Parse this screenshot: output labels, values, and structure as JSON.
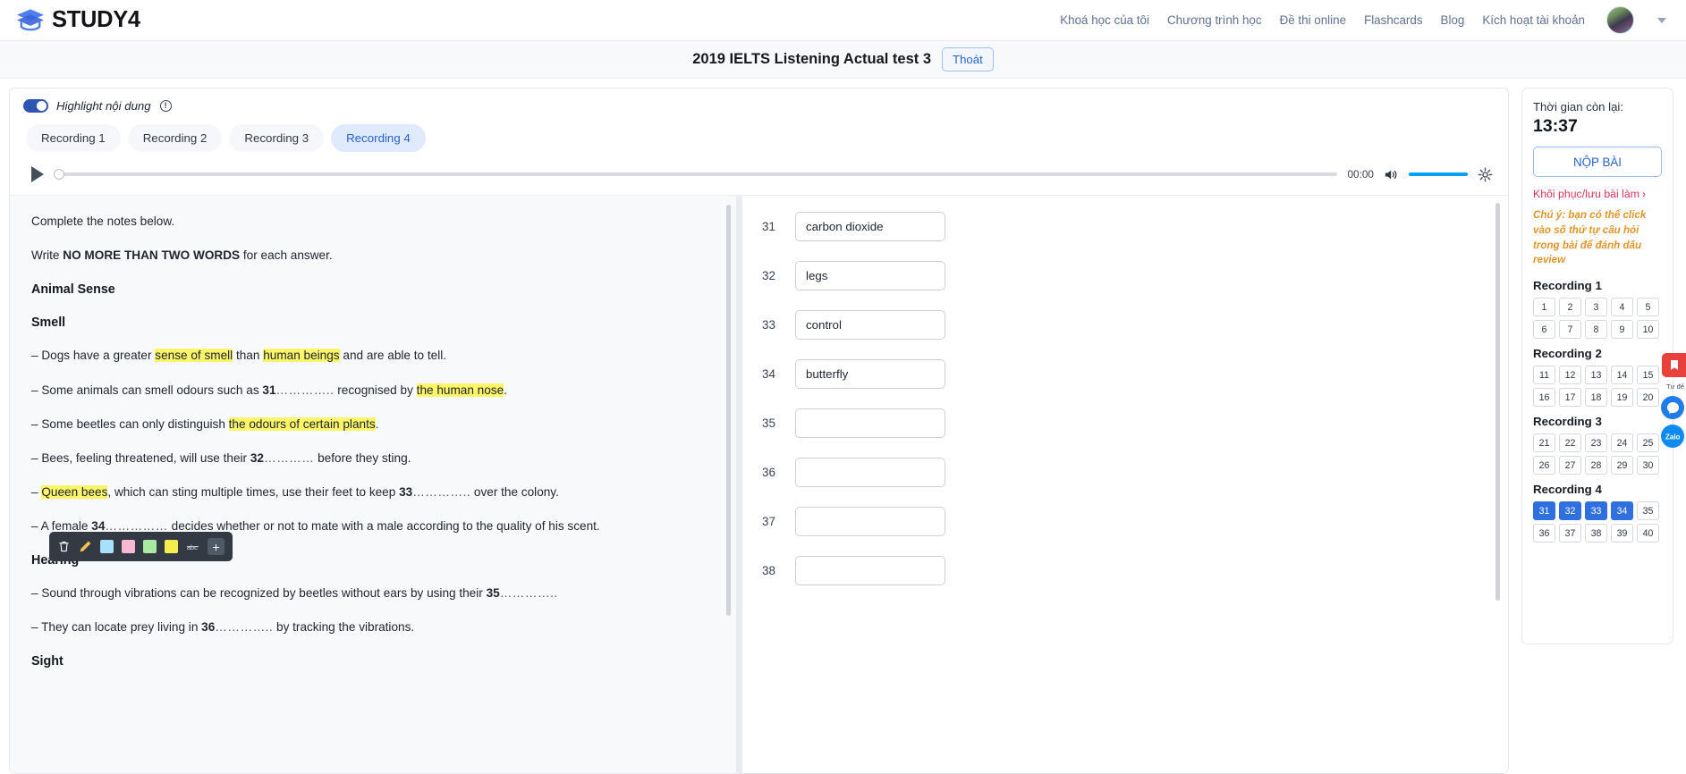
{
  "brand": {
    "name": "STUDY4"
  },
  "nav": {
    "links": [
      {
        "label": "Khoá học của tôi"
      },
      {
        "label": "Chương trình học"
      },
      {
        "label": "Đề thi online"
      },
      {
        "label": "Flashcards"
      },
      {
        "label": "Blog"
      },
      {
        "label": "Kích hoạt tài khoản"
      }
    ]
  },
  "titlebar": {
    "title": "2019 IELTS Listening Actual test 3",
    "exit_label": "Thoát"
  },
  "highlight": {
    "label": "Highlight nội dung",
    "info": "!"
  },
  "tabs": [
    {
      "label": "Recording 1",
      "active": false
    },
    {
      "label": "Recording 2",
      "active": false
    },
    {
      "label": "Recording 3",
      "active": false
    },
    {
      "label": "Recording 4",
      "active": true
    }
  ],
  "player": {
    "time": "00:00",
    "volume_pct": 100,
    "progress_pct": 0
  },
  "passage": {
    "instruction_1": "Complete the notes below.",
    "instruction_2_pre": "Write ",
    "instruction_2_bold": "NO MORE THAN TWO WORDS",
    "instruction_2_post": " for each answer.",
    "heading": "Animal Sense",
    "section_smell": "Smell",
    "section_hearing": "Hearing",
    "section_sight": "Sight",
    "line_smell_1_a": "– Dogs have a greater ",
    "line_smell_1_hl1": "sense of smell",
    "line_smell_1_b": " than ",
    "line_smell_1_hl2": "human beings",
    "line_smell_1_c": " and are able to tell.",
    "line_smell_2_a": "– Some animals can smell odours such as ",
    "line_smell_2_num": "31",
    "line_smell_2_dots": "…………..",
    "line_smell_2_b": " recognised by ",
    "line_smell_2_hl": "the human nose",
    "line_smell_2_c": ".",
    "line_smell_3_a": "– Some beetles can only distinguish ",
    "line_smell_3_hl": "the odours of certain plants",
    "line_smell_3_b": ".",
    "line_smell_4_a": "– Bees, feeling threatened, will use their ",
    "line_smell_4_num": "32",
    "line_smell_4_dots": "…………",
    "line_smell_4_b": " before they sting.",
    "line_smell_5_hl": "Queen bees",
    "line_smell_5_a": "– ",
    "line_smell_5_b": ", which can sting multiple times, use their feet to keep ",
    "line_smell_5_num": "33",
    "line_smell_5_dots": "…………..",
    "line_smell_5_c": " over the colony.",
    "line_smell_6_a": "– A female ",
    "line_smell_6_num": "34",
    "line_smell_6_dots": "……………",
    "line_smell_6_b": " decides whether or not to mate with a male according to the quality of his scent.",
    "line_hear_1_a": "– Sound through vibrations can be recognized by beetles without ears by using their ",
    "line_hear_1_num": "35",
    "line_hear_1_dots": "…………..",
    "line_hear_2_a": "– They can locate prey living in ",
    "line_hear_2_num": "36",
    "line_hear_2_dots": "…………..",
    "line_hear_2_b": " by tracking the vibrations."
  },
  "highlight_toolbar": {
    "icons": [
      "trash-icon",
      "pen-icon"
    ],
    "swatches": [
      "#a8dffb",
      "#f9b8d2",
      "#a9e9a4",
      "#f6ed4e"
    ],
    "abc_label": "abc",
    "plus_label": "+"
  },
  "answers": [
    {
      "num": "31",
      "value": "carbon dioxide"
    },
    {
      "num": "32",
      "value": "legs"
    },
    {
      "num": "33",
      "value": "control"
    },
    {
      "num": "34",
      "value": "butterfly"
    },
    {
      "num": "35",
      "value": ""
    },
    {
      "num": "36",
      "value": ""
    },
    {
      "num": "37",
      "value": ""
    },
    {
      "num": "38",
      "value": ""
    }
  ],
  "right_panel": {
    "time_label": "Thời gian còn lại:",
    "time_value": "13:37",
    "submit_label": "NỘP BÀI",
    "restore_label": "Khôi phục/lưu bài làm",
    "restore_chevron": "›",
    "note": "Chú ý: bạn có thể click vào số thứ tự câu hỏi trong bài để đánh dấu review",
    "groups": [
      {
        "title": "Recording 1",
        "questions": [
          {
            "n": "1",
            "done": false
          },
          {
            "n": "2",
            "done": false
          },
          {
            "n": "3",
            "done": false
          },
          {
            "n": "4",
            "done": false
          },
          {
            "n": "5",
            "done": false
          },
          {
            "n": "6",
            "done": false
          },
          {
            "n": "7",
            "done": false
          },
          {
            "n": "8",
            "done": false
          },
          {
            "n": "9",
            "done": false
          },
          {
            "n": "10",
            "done": false
          }
        ]
      },
      {
        "title": "Recording 2",
        "questions": [
          {
            "n": "11",
            "done": false
          },
          {
            "n": "12",
            "done": false
          },
          {
            "n": "13",
            "done": false
          },
          {
            "n": "14",
            "done": false
          },
          {
            "n": "15",
            "done": false
          },
          {
            "n": "16",
            "done": false
          },
          {
            "n": "17",
            "done": false
          },
          {
            "n": "18",
            "done": false
          },
          {
            "n": "19",
            "done": false
          },
          {
            "n": "20",
            "done": false
          }
        ]
      },
      {
        "title": "Recording 3",
        "questions": [
          {
            "n": "21",
            "done": false
          },
          {
            "n": "22",
            "done": false
          },
          {
            "n": "23",
            "done": false
          },
          {
            "n": "24",
            "done": false
          },
          {
            "n": "25",
            "done": false
          },
          {
            "n": "26",
            "done": false
          },
          {
            "n": "27",
            "done": false
          },
          {
            "n": "28",
            "done": false
          },
          {
            "n": "29",
            "done": false
          },
          {
            "n": "30",
            "done": false
          }
        ]
      },
      {
        "title": "Recording 4",
        "questions": [
          {
            "n": "31",
            "done": true
          },
          {
            "n": "32",
            "done": true
          },
          {
            "n": "33",
            "done": true
          },
          {
            "n": "34",
            "done": true
          },
          {
            "n": "35",
            "done": false
          },
          {
            "n": "36",
            "done": false
          },
          {
            "n": "37",
            "done": false
          },
          {
            "n": "38",
            "done": false
          },
          {
            "n": "39",
            "done": false
          },
          {
            "n": "40",
            "done": false
          }
        ]
      }
    ]
  },
  "float_widgets": {
    "caption": "Tư đế",
    "items": [
      "bookmark-icon",
      "messenger-icon",
      "zalo-icon"
    ]
  },
  "colors": {
    "accent_blue": "#2f6fe0",
    "highlight_yellow": "#fbf569",
    "danger_red": "#e0315a",
    "warn_orange": "#e0962c"
  }
}
